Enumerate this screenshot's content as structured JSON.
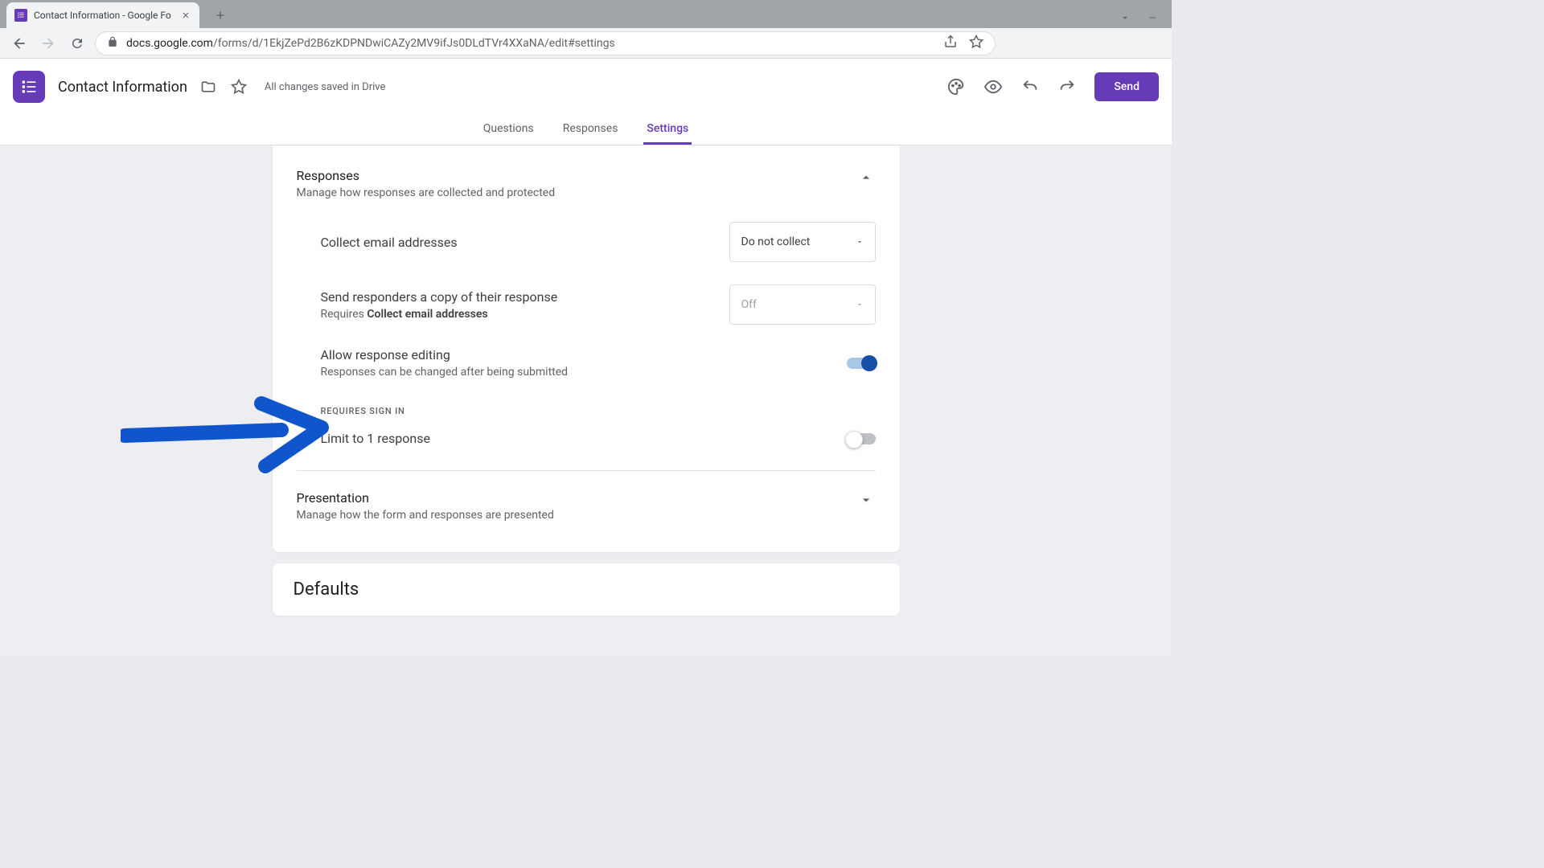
{
  "browser": {
    "tab_title": "Contact Information - Google Fo",
    "url_domain": "docs.google.com",
    "url_path": "/forms/d/1EkjZePd2B6zKDPNDwiCAZy2MV9ifJs0DLdTVr4XXaNA/edit#settings"
  },
  "header": {
    "doc_title": "Contact Information",
    "save_status": "All changes saved in Drive",
    "send_label": "Send"
  },
  "tabs": {
    "questions": "Questions",
    "responses": "Responses",
    "settings": "Settings"
  },
  "responses_section": {
    "title": "Responses",
    "subtitle": "Manage how responses are collected and protected",
    "collect_email_label": "Collect email addresses",
    "collect_email_value": "Do not collect",
    "send_copy_label": "Send responders a copy of their response",
    "send_copy_sub_prefix": "Requires ",
    "send_copy_sub_bold": "Collect email addresses",
    "send_copy_value": "Off",
    "allow_edit_label": "Allow response editing",
    "allow_edit_sub": "Responses can be changed after being submitted",
    "requires_signin": "REQUIRES SIGN IN",
    "limit_label": "Limit to 1 response"
  },
  "presentation_section": {
    "title": "Presentation",
    "subtitle": "Manage how the form and responses are presented"
  },
  "defaults_section": {
    "title": "Defaults"
  }
}
